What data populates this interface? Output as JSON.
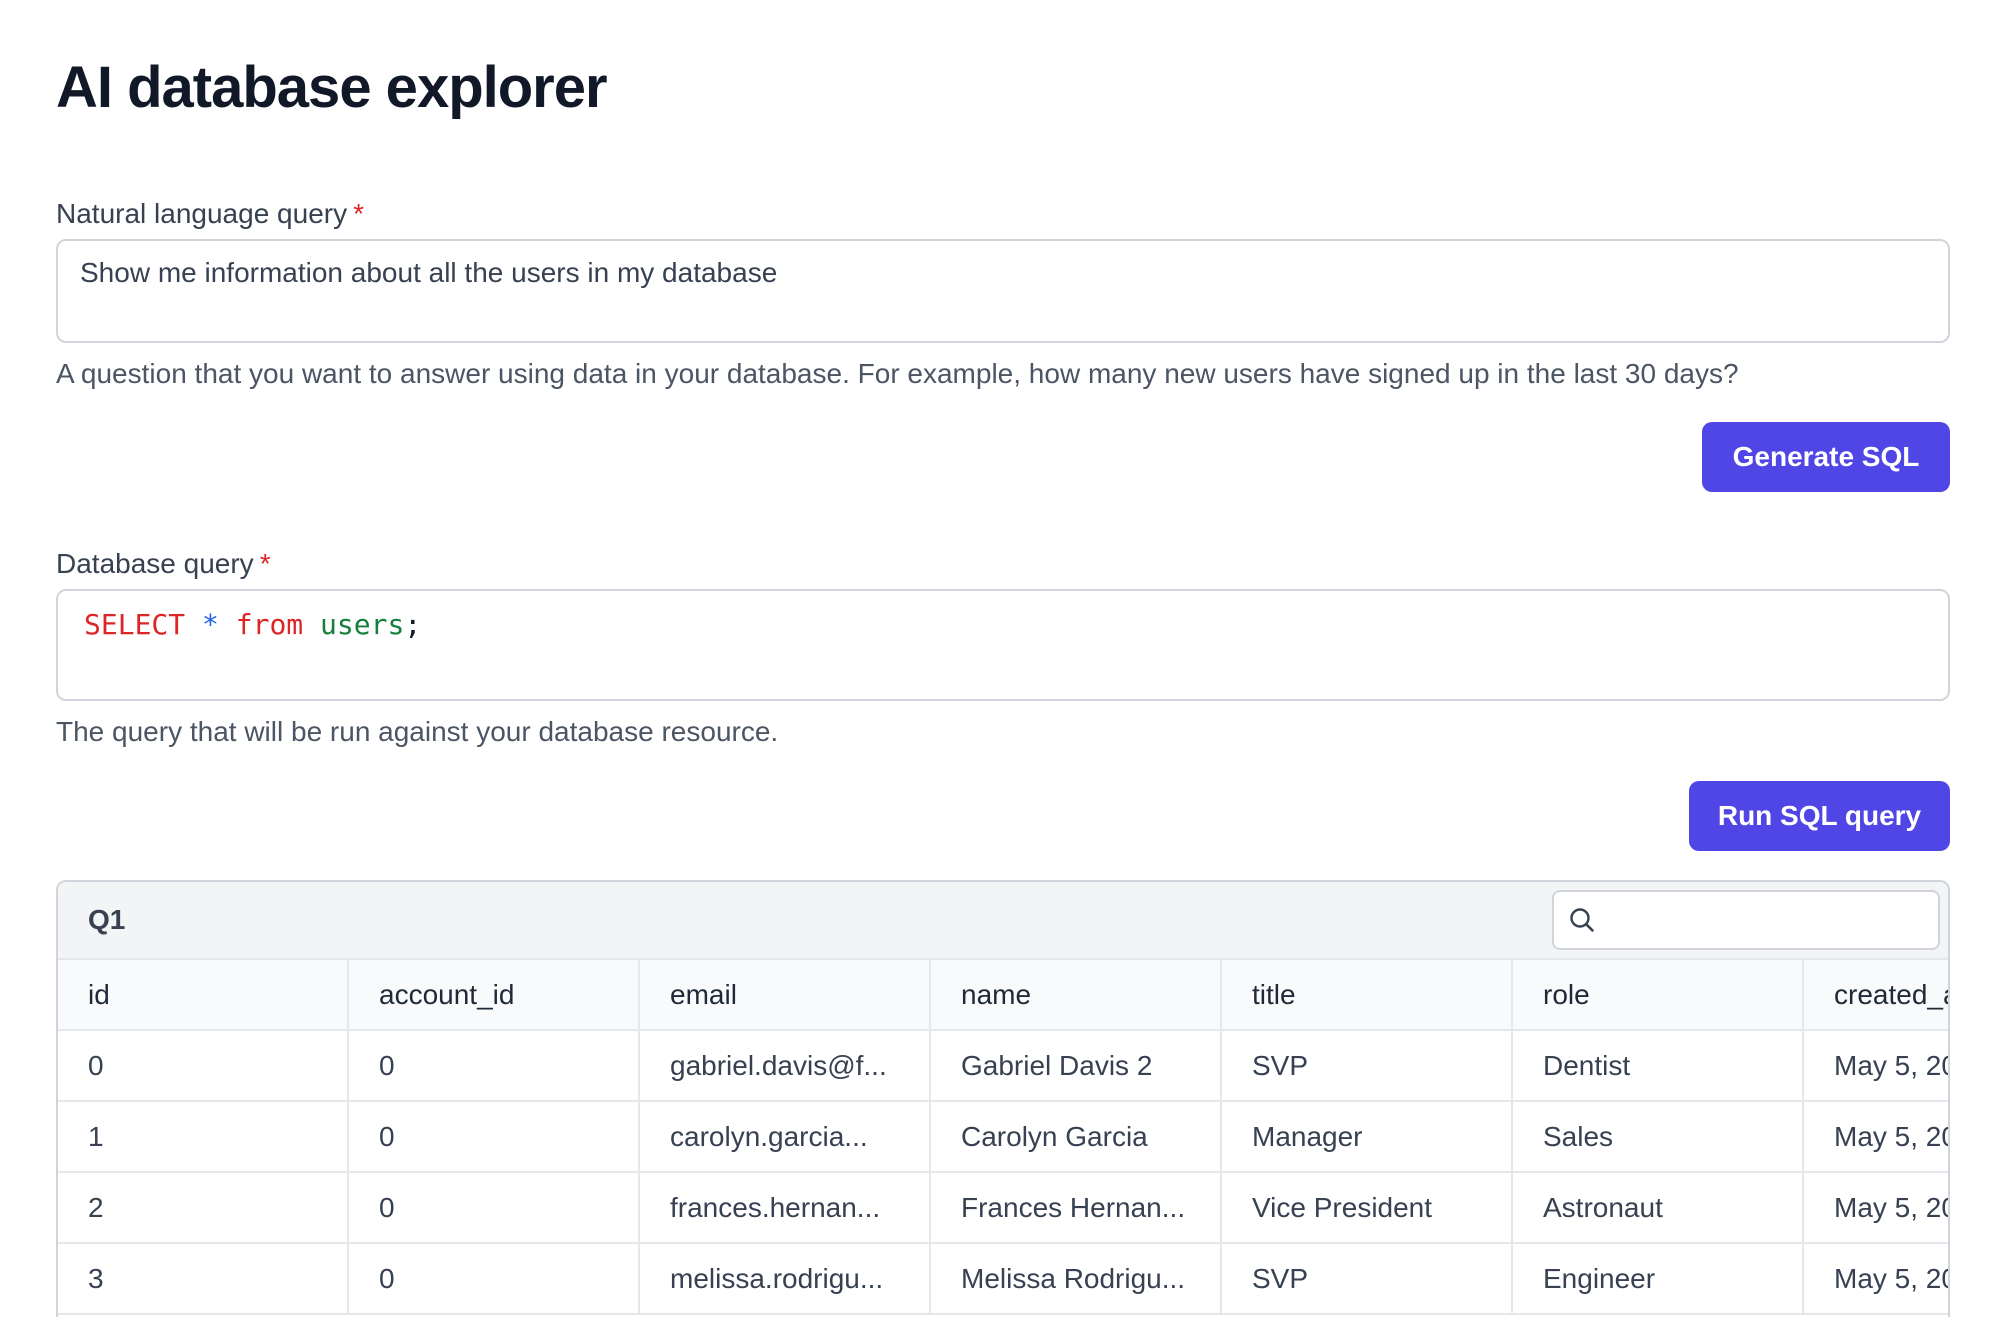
{
  "page": {
    "title": "AI database explorer"
  },
  "nl_query": {
    "label": "Natural language query",
    "required_mark": "*",
    "value": "Show me information about all the users in my database",
    "help": "A question that you want to answer using data in your database. For example, how many new users have signed up in the last 30 days?"
  },
  "generate_button": {
    "label": "Generate SQL"
  },
  "db_query": {
    "label": "Database query",
    "required_mark": "*",
    "tokens": {
      "select": "SELECT",
      "star": "*",
      "from": "from",
      "table": "users",
      "semicolon": ";"
    },
    "help": "The query that will be run against your database resource."
  },
  "run_button": {
    "label": "Run SQL query"
  },
  "results": {
    "title": "Q1",
    "search_placeholder": "",
    "columns": [
      "id",
      "account_id",
      "email",
      "name",
      "title",
      "role",
      "created_a"
    ],
    "rows": [
      [
        "0",
        "0",
        "gabriel.davis@f...",
        "Gabriel Davis 2",
        "SVP",
        "Dentist",
        "May 5, 20"
      ],
      [
        "1",
        "0",
        "carolyn.garcia...",
        "Carolyn Garcia",
        "Manager",
        "Sales",
        "May 5, 20"
      ],
      [
        "2",
        "0",
        "frances.hernan...",
        "Frances Hernan...",
        "Vice President",
        "Astronaut",
        "May 5, 20"
      ],
      [
        "3",
        "0",
        "melissa.rodrigu...",
        "Melissa Rodrigu...",
        "SVP",
        "Engineer",
        "May 5, 20"
      ]
    ]
  },
  "icons": {
    "search": "search-icon"
  },
  "colors": {
    "accent": "#4f46e5",
    "required": "#dc2626",
    "sql_keyword": "#dc2626",
    "sql_operator": "#2563eb",
    "sql_table": "#15803d"
  }
}
